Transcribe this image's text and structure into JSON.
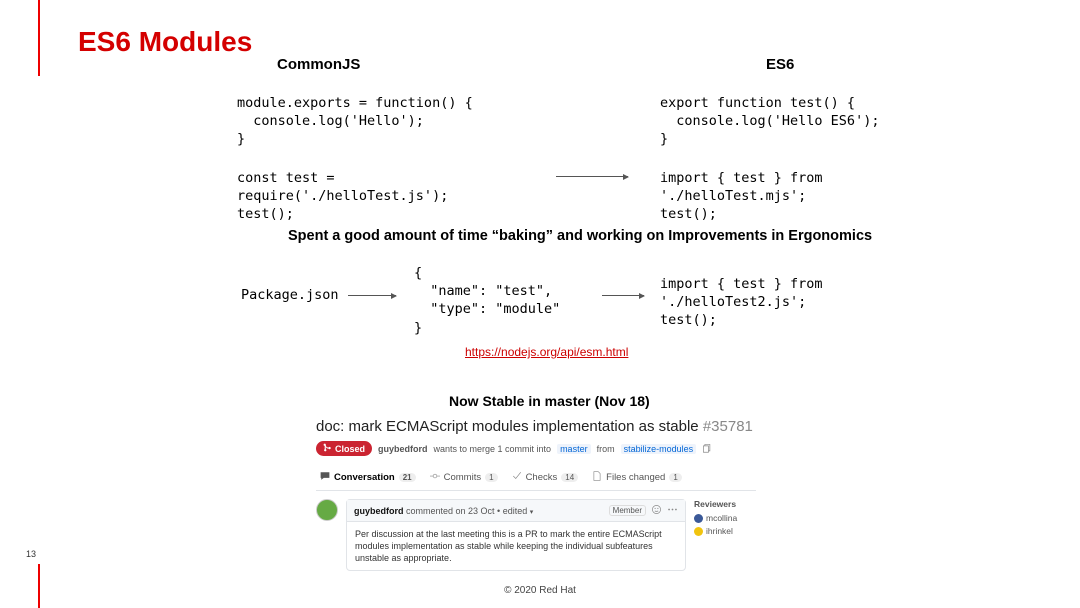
{
  "slide": {
    "title": "ES6 Modules",
    "page_number": "13",
    "copyright": "© 2020 Red Hat"
  },
  "columns": {
    "commonjs_heading": "CommonJS",
    "es6_heading": "ES6"
  },
  "code": {
    "commonjs_export": "module.exports = function() {\n  console.log('Hello');\n}",
    "es6_export": "export function test() {\n  console.log('Hello ES6');\n}",
    "commonjs_import": "const test =\nrequire('./helloTest.js');\ntest();",
    "es6_import": "import { test } from\n'./helloTest.mjs';\ntest();",
    "package_json_label": "Package.json",
    "package_json_snippet": "{\n  \"name\": \"test\",\n  \"type\": \"module\"\n}",
    "es6_import_js_ext": "import { test } from\n'./helloTest2.js';\ntest();"
  },
  "captions": {
    "baking": "Spent a good amount of time “baking” and working on Improvements in Ergonomics",
    "docs_link": "https://nodejs.org/api/esm.html",
    "stable_heading": "Now Stable in master (Nov 18)"
  },
  "pr": {
    "title": "doc: mark ECMAScript modules implementation as stable",
    "issue_id": "#35781",
    "status_badge": "Closed",
    "author": "guybedford",
    "merge_line_mid": "wants to merge 1 commit into",
    "target_branch": "master",
    "merge_line_from": "from",
    "source_branch": "stabilize-modules",
    "tabs": {
      "conversation": {
        "label": "Conversation",
        "count": "21"
      },
      "commits": {
        "label": "Commits",
        "count": "1"
      },
      "checks": {
        "label": "Checks",
        "count": "14"
      },
      "files": {
        "label": "Files changed",
        "count": "1"
      }
    },
    "comment": {
      "author": "guybedford",
      "meta": "commented on 23 Oct • edited",
      "role": "Member",
      "body": "Per discussion at the last meeting this is a PR to mark the entire ECMAScript modules implementation as stable while keeping the individual subfeatures unstable as appropriate."
    },
    "reviewers": {
      "heading": "Reviewers",
      "list": [
        {
          "name": "mcollina",
          "color": "b"
        },
        {
          "name": "ihrinkel",
          "color": "y"
        }
      ]
    }
  }
}
